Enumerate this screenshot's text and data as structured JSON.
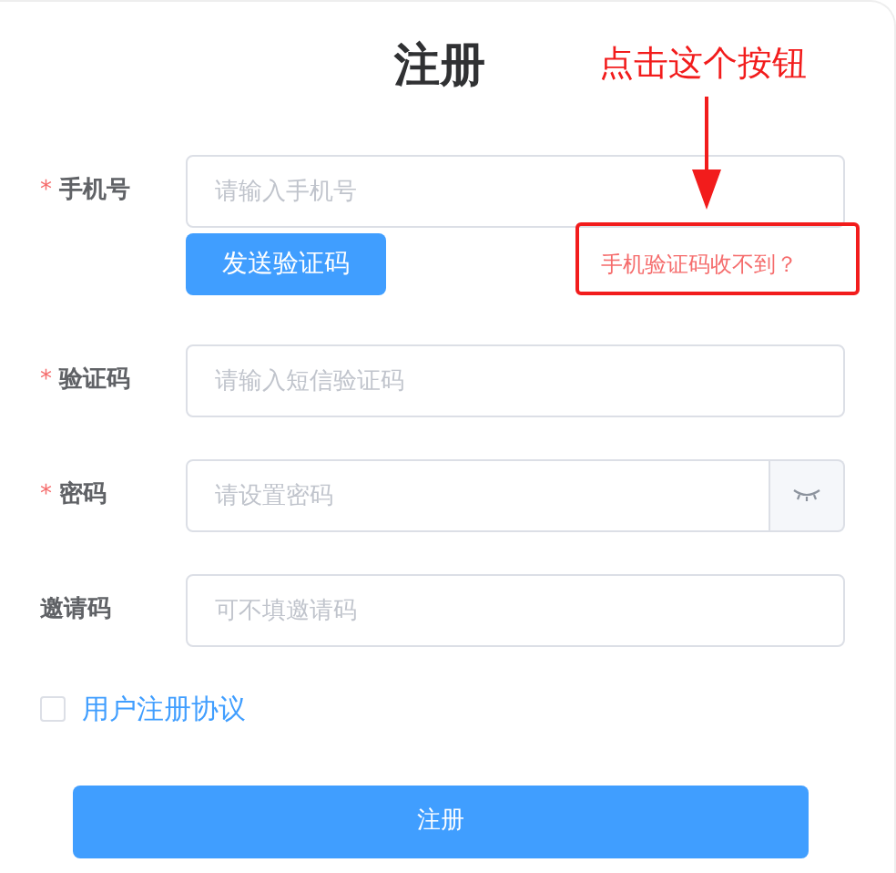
{
  "title": "注册",
  "fields": [
    {
      "label": "手机号",
      "required": true,
      "placeholder": "请输入手机号",
      "kind": "phone"
    },
    {
      "label": "验证码",
      "required": true,
      "placeholder": "请输入短信验证码",
      "kind": "text"
    },
    {
      "label": "密码",
      "required": true,
      "placeholder": "请设置密码",
      "kind": "password"
    },
    {
      "label": "邀请码",
      "required": false,
      "placeholder": "可不填邀请码",
      "kind": "text"
    }
  ],
  "send_code_button": "发送验证码",
  "help_link": "手机验证码收不到？",
  "required_mark": "*",
  "agreement": {
    "label": "用户注册协议",
    "checked": false
  },
  "submit_button": "注册",
  "annotation": {
    "text": "点击这个按钮"
  }
}
